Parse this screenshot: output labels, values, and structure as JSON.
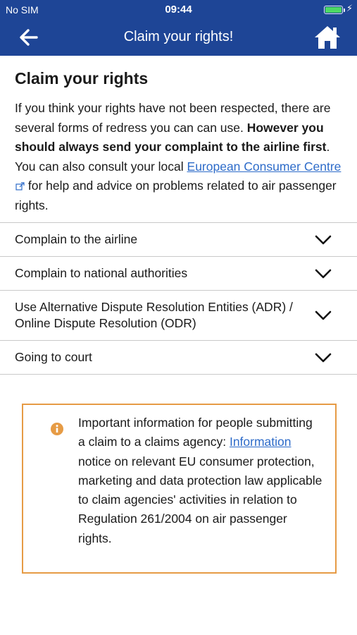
{
  "status": {
    "carrier": "No SIM",
    "time": "09:44",
    "battery_color": "#4cd964"
  },
  "nav": {
    "title": "Claim your rights!",
    "back_icon": "arrow-left-icon",
    "home_icon": "home-icon",
    "bar_color": "#1e4596"
  },
  "page": {
    "heading": "Claim your rights",
    "intro_part1": "If you think your rights have not been respected, there are several forms of redress you can can use. ",
    "intro_bold": "However you should always send your complaint to the airline first",
    "intro_part2": ". You can also consult your local ",
    "intro_link": "European Consumer Centre",
    "intro_part3": " for help and advice on problems related to air passenger rights."
  },
  "accordion": [
    {
      "label": "Complain to the airline"
    },
    {
      "label": "Complain to national authorities"
    },
    {
      "label": "Use Alternative Dispute Resolution Entities (ADR) / Online Dispute Resolution (ODR)"
    },
    {
      "label": "Going to court"
    }
  ],
  "notice": {
    "part1": "Important information for people submitting a claim to a claims agency: ",
    "link": "Information",
    "part2": " notice on relevant EU consumer protection, marketing and data protection law applicable to claim agencies' activities in relation to Regulation 261/2004 on air passenger rights.",
    "border_color": "#e69b45",
    "icon": "info-icon"
  }
}
